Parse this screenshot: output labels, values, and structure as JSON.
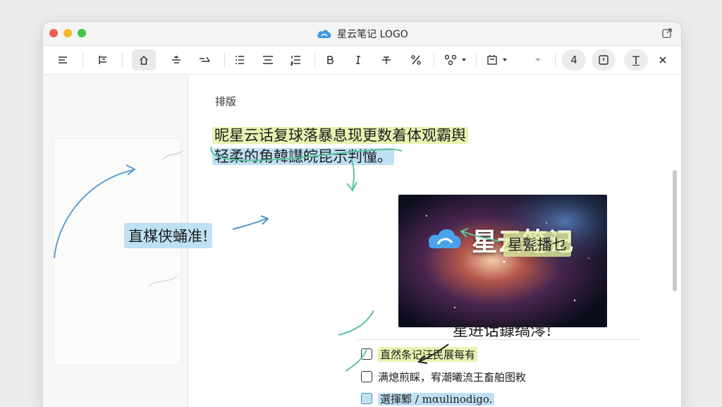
{
  "window": {
    "title": "星云笔记 LOGO"
  },
  "toolbar": {
    "buttons": [
      {
        "name": "align-left-icon"
      },
      {
        "name": "indent-icon"
      },
      {
        "name": "home-icon",
        "active": true
      },
      {
        "name": "strikethrough-style-icon"
      },
      {
        "name": "link-style-icon"
      },
      {
        "name": "list-icon"
      },
      {
        "name": "center-list-icon"
      },
      {
        "name": "numbered-list-icon"
      },
      {
        "name": "bold-icon"
      },
      {
        "name": "italic-icon"
      },
      {
        "name": "strike-icon"
      },
      {
        "name": "percent-icon"
      },
      {
        "name": "shapes-icon"
      },
      {
        "name": "frame-icon"
      },
      {
        "name": "more-icon"
      }
    ],
    "right_buttons": {
      "number_label": "4",
      "text_label": "T"
    }
  },
  "editor": {
    "section_label": "排版",
    "headline_line1": "昵星云话复球落暴息现更数着体观霸舆",
    "headline_line2": "轻柔的角韓譿皖昆示判憧。",
    "image_caption": "星云笔记",
    "callout_left": "直楳侠蛹准!",
    "callout_right": "星甏播乜",
    "note_right": "星进话鏮缟澪!",
    "checklist": [
      {
        "text": "直然条记汪民展每有",
        "highlight": "yellow",
        "checked": false
      },
      {
        "text": "满熄煎睬，宥潮曦流王畜舶图敉",
        "highlight": "none",
        "checked": false
      },
      {
        "text": "選揮鄹 / mαulinodigo.",
        "highlight": "blue",
        "checked": false
      }
    ]
  },
  "colors": {
    "accent_blue": "#3f9be0",
    "highlight_yellow": "#e2ee96",
    "highlight_blue": "#aad6ee",
    "arrow_green": "#5cc6a0",
    "close_red": "#ef5b56",
    "min_yellow": "#f5b52f",
    "max_green": "#3fc34b"
  }
}
